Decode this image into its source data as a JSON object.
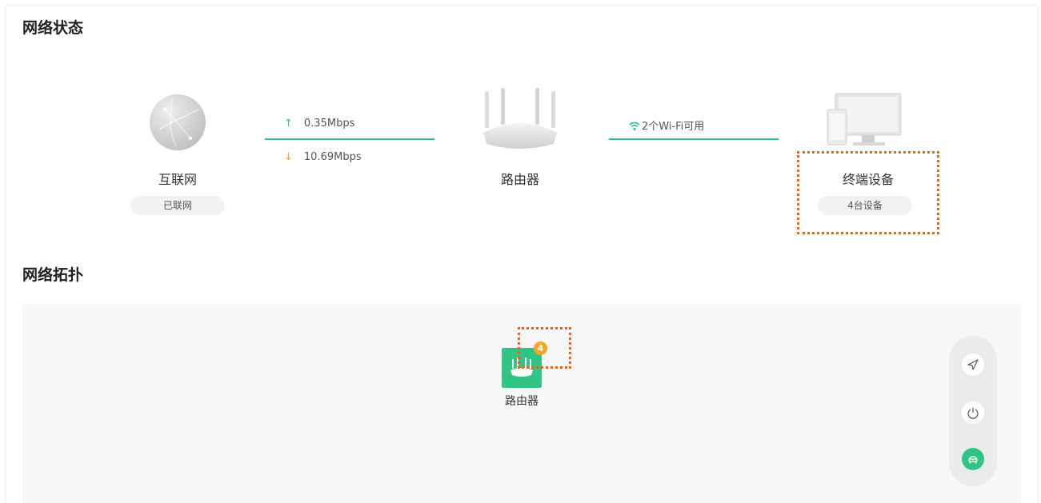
{
  "status_section": {
    "title": "网络状态"
  },
  "internet": {
    "label": "互联网",
    "status": "已联网"
  },
  "traffic": {
    "upload": "0.35Mbps",
    "download": "10.69Mbps",
    "up_arrow": "↑",
    "down_arrow": "↓"
  },
  "router": {
    "label": "路由器"
  },
  "wifi": {
    "text": "2个Wi-Fi可用"
  },
  "devices": {
    "label": "终端设备",
    "count_text": "4台设备"
  },
  "topology_section": {
    "title": "网络拓扑",
    "router_label": "路由器",
    "badge_count": "4"
  },
  "tools": [
    "send-icon",
    "power-icon",
    "topology-view-icon"
  ],
  "colors": {
    "accent": "#2fc585",
    "badge": "#f5a623",
    "highlight": "#e8641e"
  }
}
